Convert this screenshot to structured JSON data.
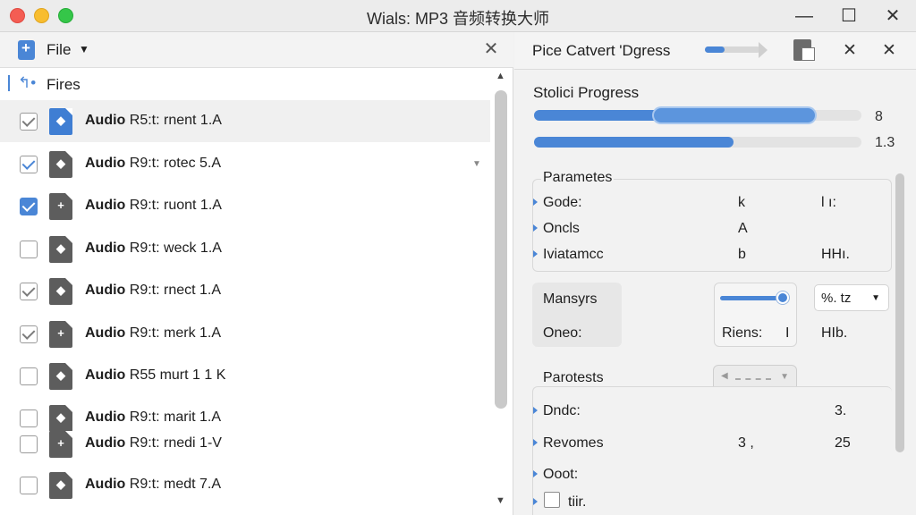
{
  "window": {
    "title": "Wials: MP3 音频转换大师",
    "controls": {
      "minimize": "—",
      "maximize": "☐",
      "close": "✕"
    }
  },
  "left_panel": {
    "header": {
      "file_label": "File",
      "caret": "▼",
      "close": "✕"
    },
    "root_label": "Fires",
    "items": [
      {
        "label": "Audio",
        "name": "R5:t: rnent 1.A",
        "checked": true,
        "style": "gray",
        "selected": true,
        "icon": "diamond"
      },
      {
        "label": "Audio",
        "name": "R9:t: rotec 5.A",
        "checked": true,
        "style": "outline",
        "selected": false,
        "icon": "diamond"
      },
      {
        "label": "Audio",
        "name": "R9:t: ruont 1.A",
        "checked": true,
        "style": "blue",
        "selected": false,
        "icon": "plus"
      },
      {
        "label": "Audio",
        "name": "R9:t: weck 1.A",
        "checked": false,
        "style": "none",
        "selected": false,
        "icon": "diamond"
      },
      {
        "label": "Audio",
        "name": "R9:t: rnect 1.A",
        "checked": true,
        "style": "gray",
        "selected": false,
        "icon": "diamond"
      },
      {
        "label": "Audio",
        "name": "R9:t: merk 1.A",
        "checked": true,
        "style": "gray",
        "selected": false,
        "icon": "plus"
      },
      {
        "label": "Audio",
        "name": "R55 murt 1 1 K",
        "checked": false,
        "style": "none",
        "selected": false,
        "icon": "diamond"
      },
      {
        "label": "Audio",
        "name": "R9:t: marit 1.A",
        "checked": false,
        "style": "none",
        "selected": false,
        "icon": "diamond"
      },
      {
        "label": "Audio",
        "name": "R9:t: rnedi 1-V",
        "checked": false,
        "style": "none",
        "selected": false,
        "icon": "plus"
      },
      {
        "label": "Audio",
        "name": "R9:t: medt 7.A",
        "checked": false,
        "style": "none",
        "selected": false,
        "icon": "diamond"
      }
    ]
  },
  "right_panel": {
    "header": {
      "title": "Pice Catvert 'Dgress",
      "close1": "✕",
      "close2": "✕"
    },
    "progress": {
      "title": "Stolici Progress",
      "bars": [
        {
          "fraction": 0.85,
          "value": "8"
        },
        {
          "fraction": 0.61,
          "value": "1.3"
        }
      ]
    },
    "parameters": {
      "title": "Parametes",
      "rows": [
        {
          "label": "Gode:",
          "v1": "k",
          "v2": "l ı:"
        },
        {
          "label": "Oncls",
          "v1": "A",
          "v2": ""
        },
        {
          "label": "Iviatamcc",
          "v1": "b",
          "v2": "HHı."
        }
      ]
    },
    "mansyrs": {
      "label1": "Mansyrs",
      "label2": "Oneo:",
      "slider_fraction": 0.92,
      "rbox": "Riens:",
      "rbox_cursor": "I",
      "select_value": "%. tz",
      "hlb": "HIb."
    },
    "parotests": {
      "title": "Parotests",
      "rows": [
        {
          "label": "Dndc:",
          "v1": "",
          "v2": "3."
        },
        {
          "label": "Revomes",
          "v1": "3 ,",
          "v2": "25"
        },
        {
          "label": "Ooot:",
          "v1": "",
          "v2": ""
        },
        {
          "label": "tiir.",
          "v1": "",
          "v2": ""
        }
      ]
    }
  }
}
